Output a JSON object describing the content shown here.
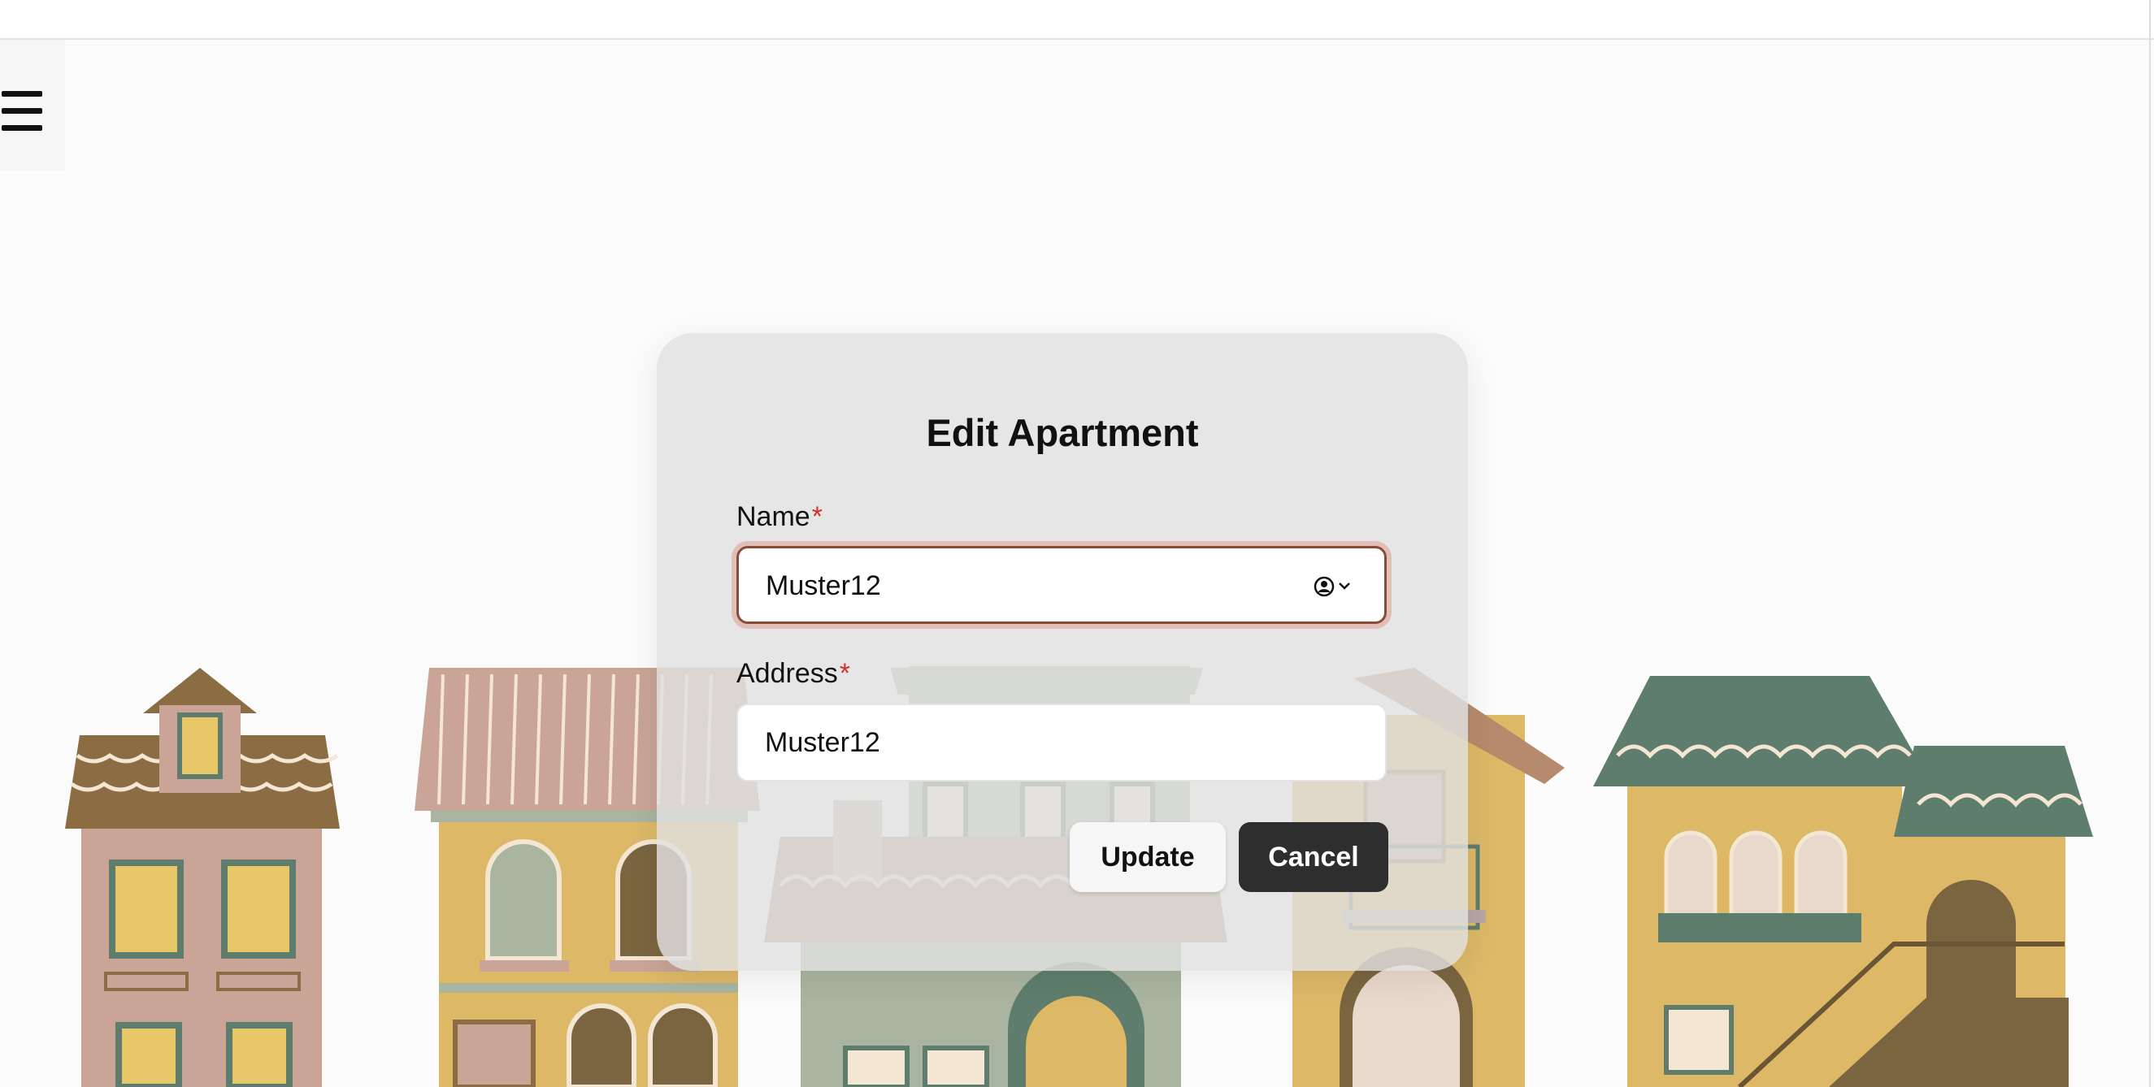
{
  "form": {
    "title": "Edit Apartment",
    "required_marker": "*",
    "fields": [
      {
        "label": "Name",
        "value": "Muster12",
        "focused": true,
        "autofill_icon": "user-circle-icon"
      },
      {
        "label": "Address",
        "value": "Muster12",
        "focused": false
      }
    ],
    "buttons": {
      "update": "Update",
      "cancel": "Cancel"
    }
  },
  "icons": {
    "menu": "hamburger-menu-icon"
  },
  "colors": {
    "page_bg": "#fbfbfb",
    "card_bg": "#e1e1e1",
    "required": "#d32f2f",
    "focus_ring": "#dba08c",
    "cancel_bg": "#2e2e2e",
    "house_pink": "#c9a497",
    "house_yellow": "#dcb867",
    "house_green": "#5f7d6c",
    "house_sage": "#a9b5a0"
  }
}
